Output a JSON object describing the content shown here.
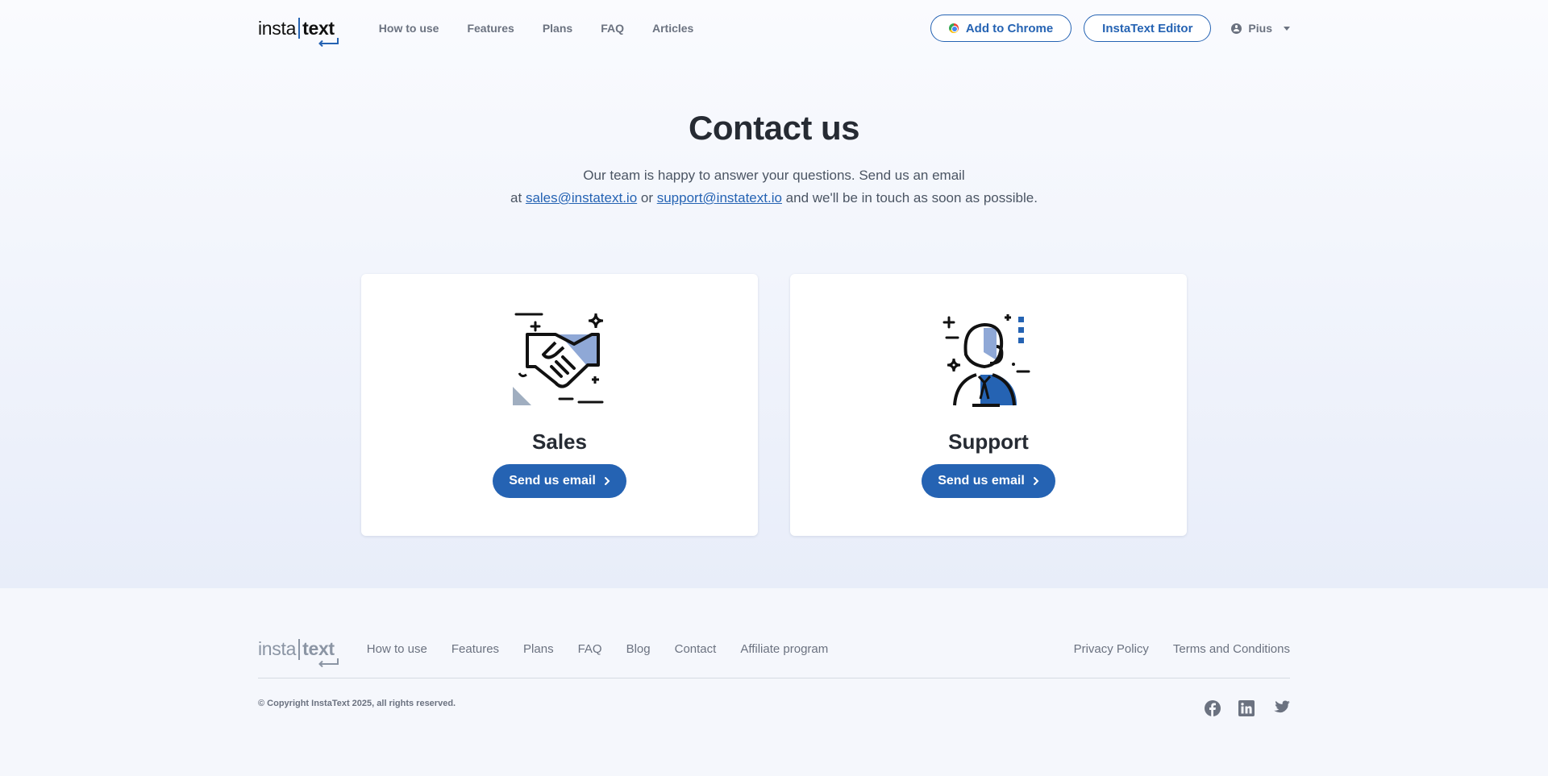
{
  "header": {
    "logo_left": "insta",
    "logo_right": "text",
    "nav": [
      "How to use",
      "Features",
      "Plans",
      "FAQ",
      "Articles"
    ],
    "add_to_chrome": "Add to Chrome",
    "editor_button": "InstaText Editor",
    "user_name": "Pius"
  },
  "hero": {
    "title": "Contact us",
    "line1": "Our team is happy to answer your questions. Send us an email",
    "line2_prefix": "at ",
    "sales_email": "sales@instatext.io",
    "or": " or ",
    "support_email": "support@instatext.io",
    "line2_suffix": " and we'll be in touch as soon as possible."
  },
  "cards": {
    "sales": {
      "title": "Sales",
      "button": "Send us email",
      "icon": "handshake-icon"
    },
    "support": {
      "title": "Support",
      "button": "Send us email",
      "icon": "support-agent-icon"
    }
  },
  "footer": {
    "logo_left": "insta",
    "logo_right": "text",
    "nav": [
      "How to use",
      "Features",
      "Plans",
      "FAQ",
      "Blog",
      "Contact",
      "Affiliate program"
    ],
    "privacy": "Privacy Policy",
    "terms": "Terms and Conditions",
    "copyright": "© Copyright InstaText 2025, all rights reserved.",
    "social": [
      "facebook-icon",
      "linkedin-icon",
      "twitter-icon"
    ]
  },
  "colors": {
    "brand": "#2563b3",
    "muted": "#6b7280",
    "title": "#262b33"
  }
}
